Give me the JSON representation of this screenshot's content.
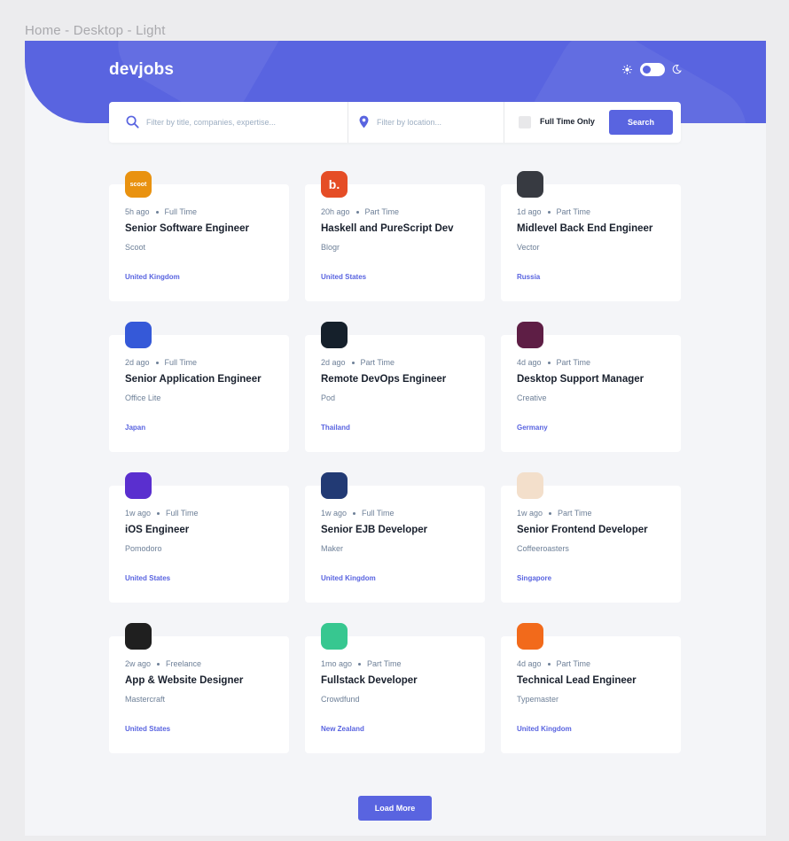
{
  "frame_label": "Home - Desktop - Light",
  "logo": "devjobs",
  "colors": {
    "accent": "#5964e0",
    "title": "#19202d",
    "muted": "#6e8098"
  },
  "search": {
    "title_placeholder": "Filter by title, companies, expertise...",
    "location_placeholder": "Filter by location...",
    "full_time_label": "Full Time Only",
    "button_label": "Search"
  },
  "jobs": [
    {
      "posted": "5h ago",
      "contract": "Full Time",
      "title": "Senior Software Engineer",
      "company": "Scoot",
      "location": "United Kingdom",
      "logo_color": "#e99210",
      "logo_text": "scoot",
      "logo_icon": "scoot-logo-icon"
    },
    {
      "posted": "20h ago",
      "contract": "Part Time",
      "title": "Haskell and PureScript Dev",
      "company": "Blogr",
      "location": "United States",
      "logo_color": "#e54d26",
      "logo_text": "b.",
      "logo_icon": "blogr-logo-icon"
    },
    {
      "posted": "1d ago",
      "contract": "Part Time",
      "title": "Midlevel Back End Engineer",
      "company": "Vector",
      "location": "Russia",
      "logo_color": "#373a41",
      "logo_text": "",
      "logo_icon": "vector-logo-icon"
    },
    {
      "posted": "2d ago",
      "contract": "Full Time",
      "title": "Senior Application Engineer",
      "company": "Office Lite",
      "location": "Japan",
      "logo_color": "#3559d8",
      "logo_text": "",
      "logo_icon": "office-lite-logo-icon"
    },
    {
      "posted": "2d ago",
      "contract": "Part Time",
      "title": "Remote DevOps Engineer",
      "company": "Pod",
      "location": "Thailand",
      "logo_color": "#15202b",
      "logo_text": "",
      "logo_icon": "pod-logo-icon"
    },
    {
      "posted": "4d ago",
      "contract": "Part Time",
      "title": "Desktop Support Manager",
      "company": "Creative",
      "location": "Germany",
      "logo_color": "#5e1e45",
      "logo_text": "",
      "logo_icon": "creative-logo-icon"
    },
    {
      "posted": "1w ago",
      "contract": "Full Time",
      "title": "iOS Engineer",
      "company": "Pomodoro",
      "location": "United States",
      "logo_color": "#5a2fcf",
      "logo_text": "",
      "logo_icon": "pomodoro-logo-icon"
    },
    {
      "posted": "1w ago",
      "contract": "Full Time",
      "title": "Senior EJB Developer",
      "company": "Maker",
      "location": "United Kingdom",
      "logo_color": "#223a74",
      "logo_text": "",
      "logo_icon": "maker-logo-icon"
    },
    {
      "posted": "1w ago",
      "contract": "Part Time",
      "title": "Senior Frontend Developer",
      "company": "Coffeeroasters",
      "location": "Singapore",
      "logo_color": "#f3dfcb",
      "logo_text": "",
      "logo_icon": "coffeeroasters-logo-icon"
    },
    {
      "posted": "2w ago",
      "contract": "Freelance",
      "title": "App & Website Designer",
      "company": "Mastercraft",
      "location": "United States",
      "logo_color": "#1f1f1f",
      "logo_text": "",
      "logo_icon": "mastercraft-logo-icon"
    },
    {
      "posted": "1mo ago",
      "contract": "Part Time",
      "title": "Fullstack Developer",
      "company": "Crowdfund",
      "location": "New Zealand",
      "logo_color": "#37c790",
      "logo_text": "",
      "logo_icon": "crowdfund-logo-icon"
    },
    {
      "posted": "4d ago",
      "contract": "Part Time",
      "title": "Technical Lead Engineer",
      "company": "Typemaster",
      "location": "United Kingdom",
      "logo_color": "#f26a1b",
      "logo_text": "",
      "logo_icon": "typemaster-logo-icon"
    }
  ],
  "load_more_label": "Load More"
}
